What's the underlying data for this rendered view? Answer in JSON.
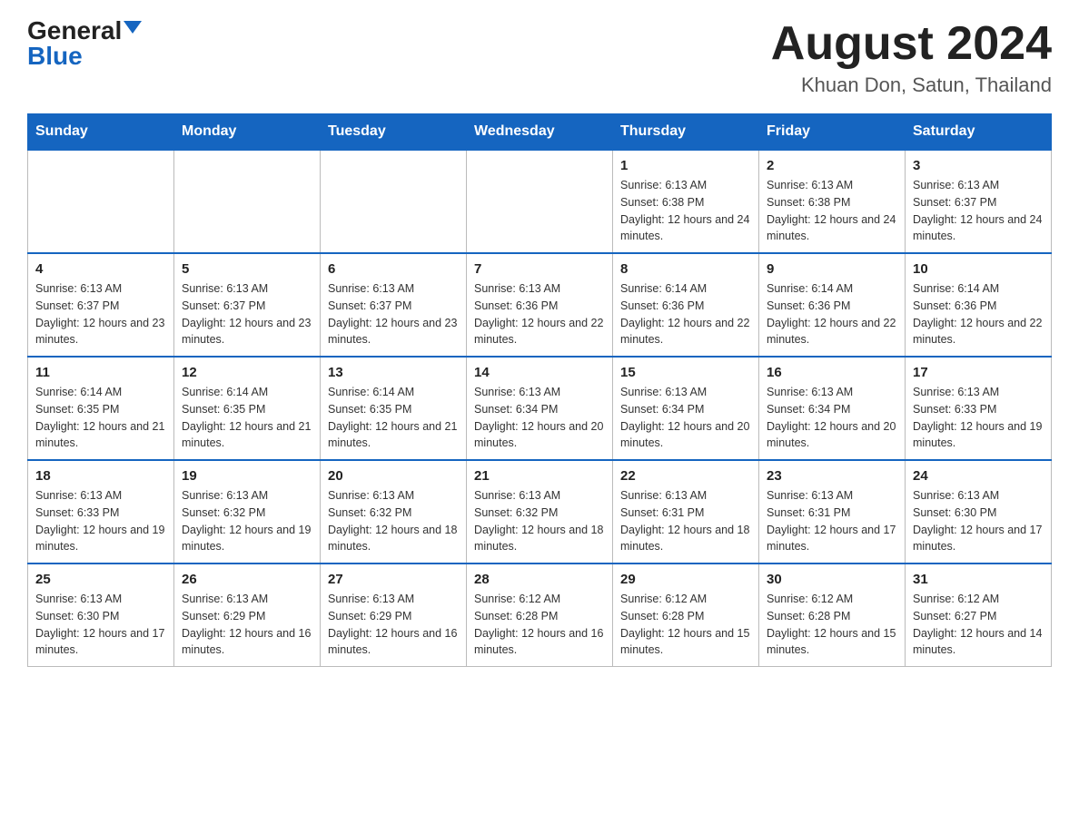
{
  "header": {
    "logo_general": "General",
    "logo_blue": "Blue",
    "month_title": "August 2024",
    "location": "Khuan Don, Satun, Thailand"
  },
  "days_of_week": [
    "Sunday",
    "Monday",
    "Tuesday",
    "Wednesday",
    "Thursday",
    "Friday",
    "Saturday"
  ],
  "weeks": [
    [
      {
        "day": "",
        "info": ""
      },
      {
        "day": "",
        "info": ""
      },
      {
        "day": "",
        "info": ""
      },
      {
        "day": "",
        "info": ""
      },
      {
        "day": "1",
        "info": "Sunrise: 6:13 AM\nSunset: 6:38 PM\nDaylight: 12 hours and 24 minutes."
      },
      {
        "day": "2",
        "info": "Sunrise: 6:13 AM\nSunset: 6:38 PM\nDaylight: 12 hours and 24 minutes."
      },
      {
        "day": "3",
        "info": "Sunrise: 6:13 AM\nSunset: 6:37 PM\nDaylight: 12 hours and 24 minutes."
      }
    ],
    [
      {
        "day": "4",
        "info": "Sunrise: 6:13 AM\nSunset: 6:37 PM\nDaylight: 12 hours and 23 minutes."
      },
      {
        "day": "5",
        "info": "Sunrise: 6:13 AM\nSunset: 6:37 PM\nDaylight: 12 hours and 23 minutes."
      },
      {
        "day": "6",
        "info": "Sunrise: 6:13 AM\nSunset: 6:37 PM\nDaylight: 12 hours and 23 minutes."
      },
      {
        "day": "7",
        "info": "Sunrise: 6:13 AM\nSunset: 6:36 PM\nDaylight: 12 hours and 22 minutes."
      },
      {
        "day": "8",
        "info": "Sunrise: 6:14 AM\nSunset: 6:36 PM\nDaylight: 12 hours and 22 minutes."
      },
      {
        "day": "9",
        "info": "Sunrise: 6:14 AM\nSunset: 6:36 PM\nDaylight: 12 hours and 22 minutes."
      },
      {
        "day": "10",
        "info": "Sunrise: 6:14 AM\nSunset: 6:36 PM\nDaylight: 12 hours and 22 minutes."
      }
    ],
    [
      {
        "day": "11",
        "info": "Sunrise: 6:14 AM\nSunset: 6:35 PM\nDaylight: 12 hours and 21 minutes."
      },
      {
        "day": "12",
        "info": "Sunrise: 6:14 AM\nSunset: 6:35 PM\nDaylight: 12 hours and 21 minutes."
      },
      {
        "day": "13",
        "info": "Sunrise: 6:14 AM\nSunset: 6:35 PM\nDaylight: 12 hours and 21 minutes."
      },
      {
        "day": "14",
        "info": "Sunrise: 6:13 AM\nSunset: 6:34 PM\nDaylight: 12 hours and 20 minutes."
      },
      {
        "day": "15",
        "info": "Sunrise: 6:13 AM\nSunset: 6:34 PM\nDaylight: 12 hours and 20 minutes."
      },
      {
        "day": "16",
        "info": "Sunrise: 6:13 AM\nSunset: 6:34 PM\nDaylight: 12 hours and 20 minutes."
      },
      {
        "day": "17",
        "info": "Sunrise: 6:13 AM\nSunset: 6:33 PM\nDaylight: 12 hours and 19 minutes."
      }
    ],
    [
      {
        "day": "18",
        "info": "Sunrise: 6:13 AM\nSunset: 6:33 PM\nDaylight: 12 hours and 19 minutes."
      },
      {
        "day": "19",
        "info": "Sunrise: 6:13 AM\nSunset: 6:32 PM\nDaylight: 12 hours and 19 minutes."
      },
      {
        "day": "20",
        "info": "Sunrise: 6:13 AM\nSunset: 6:32 PM\nDaylight: 12 hours and 18 minutes."
      },
      {
        "day": "21",
        "info": "Sunrise: 6:13 AM\nSunset: 6:32 PM\nDaylight: 12 hours and 18 minutes."
      },
      {
        "day": "22",
        "info": "Sunrise: 6:13 AM\nSunset: 6:31 PM\nDaylight: 12 hours and 18 minutes."
      },
      {
        "day": "23",
        "info": "Sunrise: 6:13 AM\nSunset: 6:31 PM\nDaylight: 12 hours and 17 minutes."
      },
      {
        "day": "24",
        "info": "Sunrise: 6:13 AM\nSunset: 6:30 PM\nDaylight: 12 hours and 17 minutes."
      }
    ],
    [
      {
        "day": "25",
        "info": "Sunrise: 6:13 AM\nSunset: 6:30 PM\nDaylight: 12 hours and 17 minutes."
      },
      {
        "day": "26",
        "info": "Sunrise: 6:13 AM\nSunset: 6:29 PM\nDaylight: 12 hours and 16 minutes."
      },
      {
        "day": "27",
        "info": "Sunrise: 6:13 AM\nSunset: 6:29 PM\nDaylight: 12 hours and 16 minutes."
      },
      {
        "day": "28",
        "info": "Sunrise: 6:12 AM\nSunset: 6:28 PM\nDaylight: 12 hours and 16 minutes."
      },
      {
        "day": "29",
        "info": "Sunrise: 6:12 AM\nSunset: 6:28 PM\nDaylight: 12 hours and 15 minutes."
      },
      {
        "day": "30",
        "info": "Sunrise: 6:12 AM\nSunset: 6:28 PM\nDaylight: 12 hours and 15 minutes."
      },
      {
        "day": "31",
        "info": "Sunrise: 6:12 AM\nSunset: 6:27 PM\nDaylight: 12 hours and 14 minutes."
      }
    ]
  ]
}
